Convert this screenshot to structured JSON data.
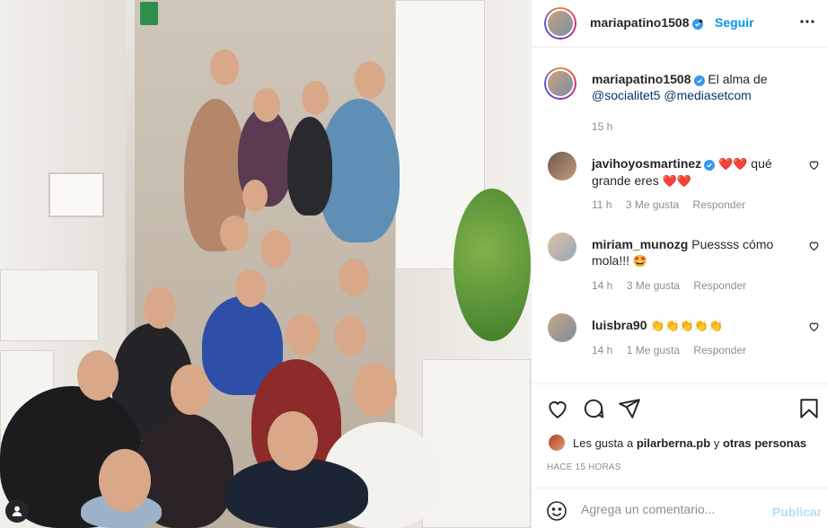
{
  "header": {
    "username": "mariapatino1508",
    "separator": "•",
    "follow_label": "Seguir"
  },
  "caption": {
    "username": "mariapatino1508",
    "text": "El alma de",
    "mention1": "@socialitet5",
    "mention2": "@mediasetcom",
    "time": "15 h"
  },
  "comments": [
    {
      "username": "javihoyosmartinez",
      "verified": true,
      "text_before": "",
      "emoji": "❤️❤️",
      "text_after": " qué grande eres ",
      "emoji_after": "❤️❤️",
      "time": "11 h",
      "likes": "3 Me gusta",
      "reply": "Responder"
    },
    {
      "username": "miriam_munozg",
      "text": "Puessss cómo mola!!! ",
      "emoji": "🤩",
      "time": "14 h",
      "likes": "3 Me gusta",
      "reply": "Responder"
    },
    {
      "username": "luisbra90",
      "text": "",
      "emoji": "👏👏👏👏👏",
      "time": "14 h",
      "likes": "1 Me gusta",
      "reply": "Responder"
    }
  ],
  "likes": {
    "prefix": "Les gusta a",
    "user": "pilarberna.pb",
    "connector": "y",
    "others": "otras personas"
  },
  "posted_ago": "HACE 15 HORAS",
  "add_comment": {
    "placeholder": "Agrega un comentario...",
    "publish_label": "Publicar"
  },
  "colors": {
    "accent": "#0095f6",
    "verified": "#3897f0",
    "mention": "#00376b",
    "muted": "#8e8e8e",
    "publish_disabled": "#b2dffc"
  },
  "icons": [
    "verified-badge-icon",
    "more-options-icon",
    "heart-icon",
    "comment-icon",
    "share-icon",
    "bookmark-icon",
    "smile-icon",
    "user-tag-icon"
  ]
}
